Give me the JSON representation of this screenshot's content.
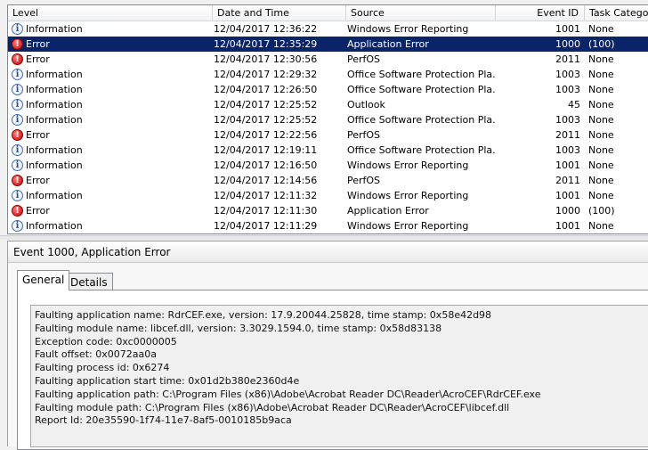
{
  "columns": {
    "level": "Level",
    "date": "Date and Time",
    "source": "Source",
    "event_id": "Event ID",
    "task": "Task Category"
  },
  "events": [
    {
      "level": "Information",
      "type": "info",
      "date": "12/04/2017 12:36:22",
      "source": "Windows Error Reporting",
      "event_id": "1001",
      "task": "None"
    },
    {
      "level": "Error",
      "type": "error",
      "date": "12/04/2017 12:35:29",
      "source": "Application Error",
      "event_id": "1000",
      "task": "(100)",
      "selected": true
    },
    {
      "level": "Error",
      "type": "error",
      "date": "12/04/2017 12:30:56",
      "source": "PerfOS",
      "event_id": "2011",
      "task": "None"
    },
    {
      "level": "Information",
      "type": "info",
      "date": "12/04/2017 12:29:32",
      "source": "Office Software Protection Pla...",
      "event_id": "1003",
      "task": "None"
    },
    {
      "level": "Information",
      "type": "info",
      "date": "12/04/2017 12:26:50",
      "source": "Office Software Protection Pla...",
      "event_id": "1003",
      "task": "None"
    },
    {
      "level": "Information",
      "type": "info",
      "date": "12/04/2017 12:25:52",
      "source": "Outlook",
      "event_id": "45",
      "task": "None"
    },
    {
      "level": "Information",
      "type": "info",
      "date": "12/04/2017 12:25:52",
      "source": "Office Software Protection Pla...",
      "event_id": "1003",
      "task": "None"
    },
    {
      "level": "Error",
      "type": "error",
      "date": "12/04/2017 12:22:56",
      "source": "PerfOS",
      "event_id": "2011",
      "task": "None"
    },
    {
      "level": "Information",
      "type": "info",
      "date": "12/04/2017 12:19:11",
      "source": "Office Software Protection Pla...",
      "event_id": "1003",
      "task": "None"
    },
    {
      "level": "Information",
      "type": "info",
      "date": "12/04/2017 12:16:50",
      "source": "Windows Error Reporting",
      "event_id": "1001",
      "task": "None"
    },
    {
      "level": "Error",
      "type": "error",
      "date": "12/04/2017 12:14:56",
      "source": "PerfOS",
      "event_id": "2011",
      "task": "None"
    },
    {
      "level": "Information",
      "type": "info",
      "date": "12/04/2017 12:11:32",
      "source": "Windows Error Reporting",
      "event_id": "1001",
      "task": "None"
    },
    {
      "level": "Error",
      "type": "error",
      "date": "12/04/2017 12:11:30",
      "source": "Application Error",
      "event_id": "1000",
      "task": "(100)"
    },
    {
      "level": "Information",
      "type": "info",
      "date": "12/04/2017 12:11:29",
      "source": "Windows Error Reporting",
      "event_id": "1001",
      "task": "None"
    }
  ],
  "icons": {
    "info": "information-icon",
    "error": "error-icon"
  },
  "colors": {
    "selection": "#0a246a",
    "error": "#c40000",
    "info": "#3f6bb0"
  },
  "detail": {
    "title": "Event 1000, Application Error",
    "tabs": [
      "General",
      "Details"
    ],
    "active_tab": "General",
    "description": [
      "Faulting application name: RdrCEF.exe, version: 17.9.20044.25828, time stamp: 0x58e42d98",
      "Faulting module name: libcef.dll, version: 3.3029.1594.0, time stamp: 0x58d83138",
      "Exception code: 0xc0000005",
      "Fault offset: 0x0072aa0a",
      "Faulting process id: 0x6274",
      "Faulting application start time: 0x01d2b380e2360d4e",
      "Faulting application path: C:\\Program Files (x86)\\Adobe\\Acrobat Reader DC\\Reader\\AcroCEF\\RdrCEF.exe",
      "Faulting module path: C:\\Program Files (x86)\\Adobe\\Acrobat Reader DC\\Reader\\AcroCEF\\libcef.dll",
      "Report Id: 20e35590-1f74-11e7-8af5-0010185b9aca"
    ]
  }
}
